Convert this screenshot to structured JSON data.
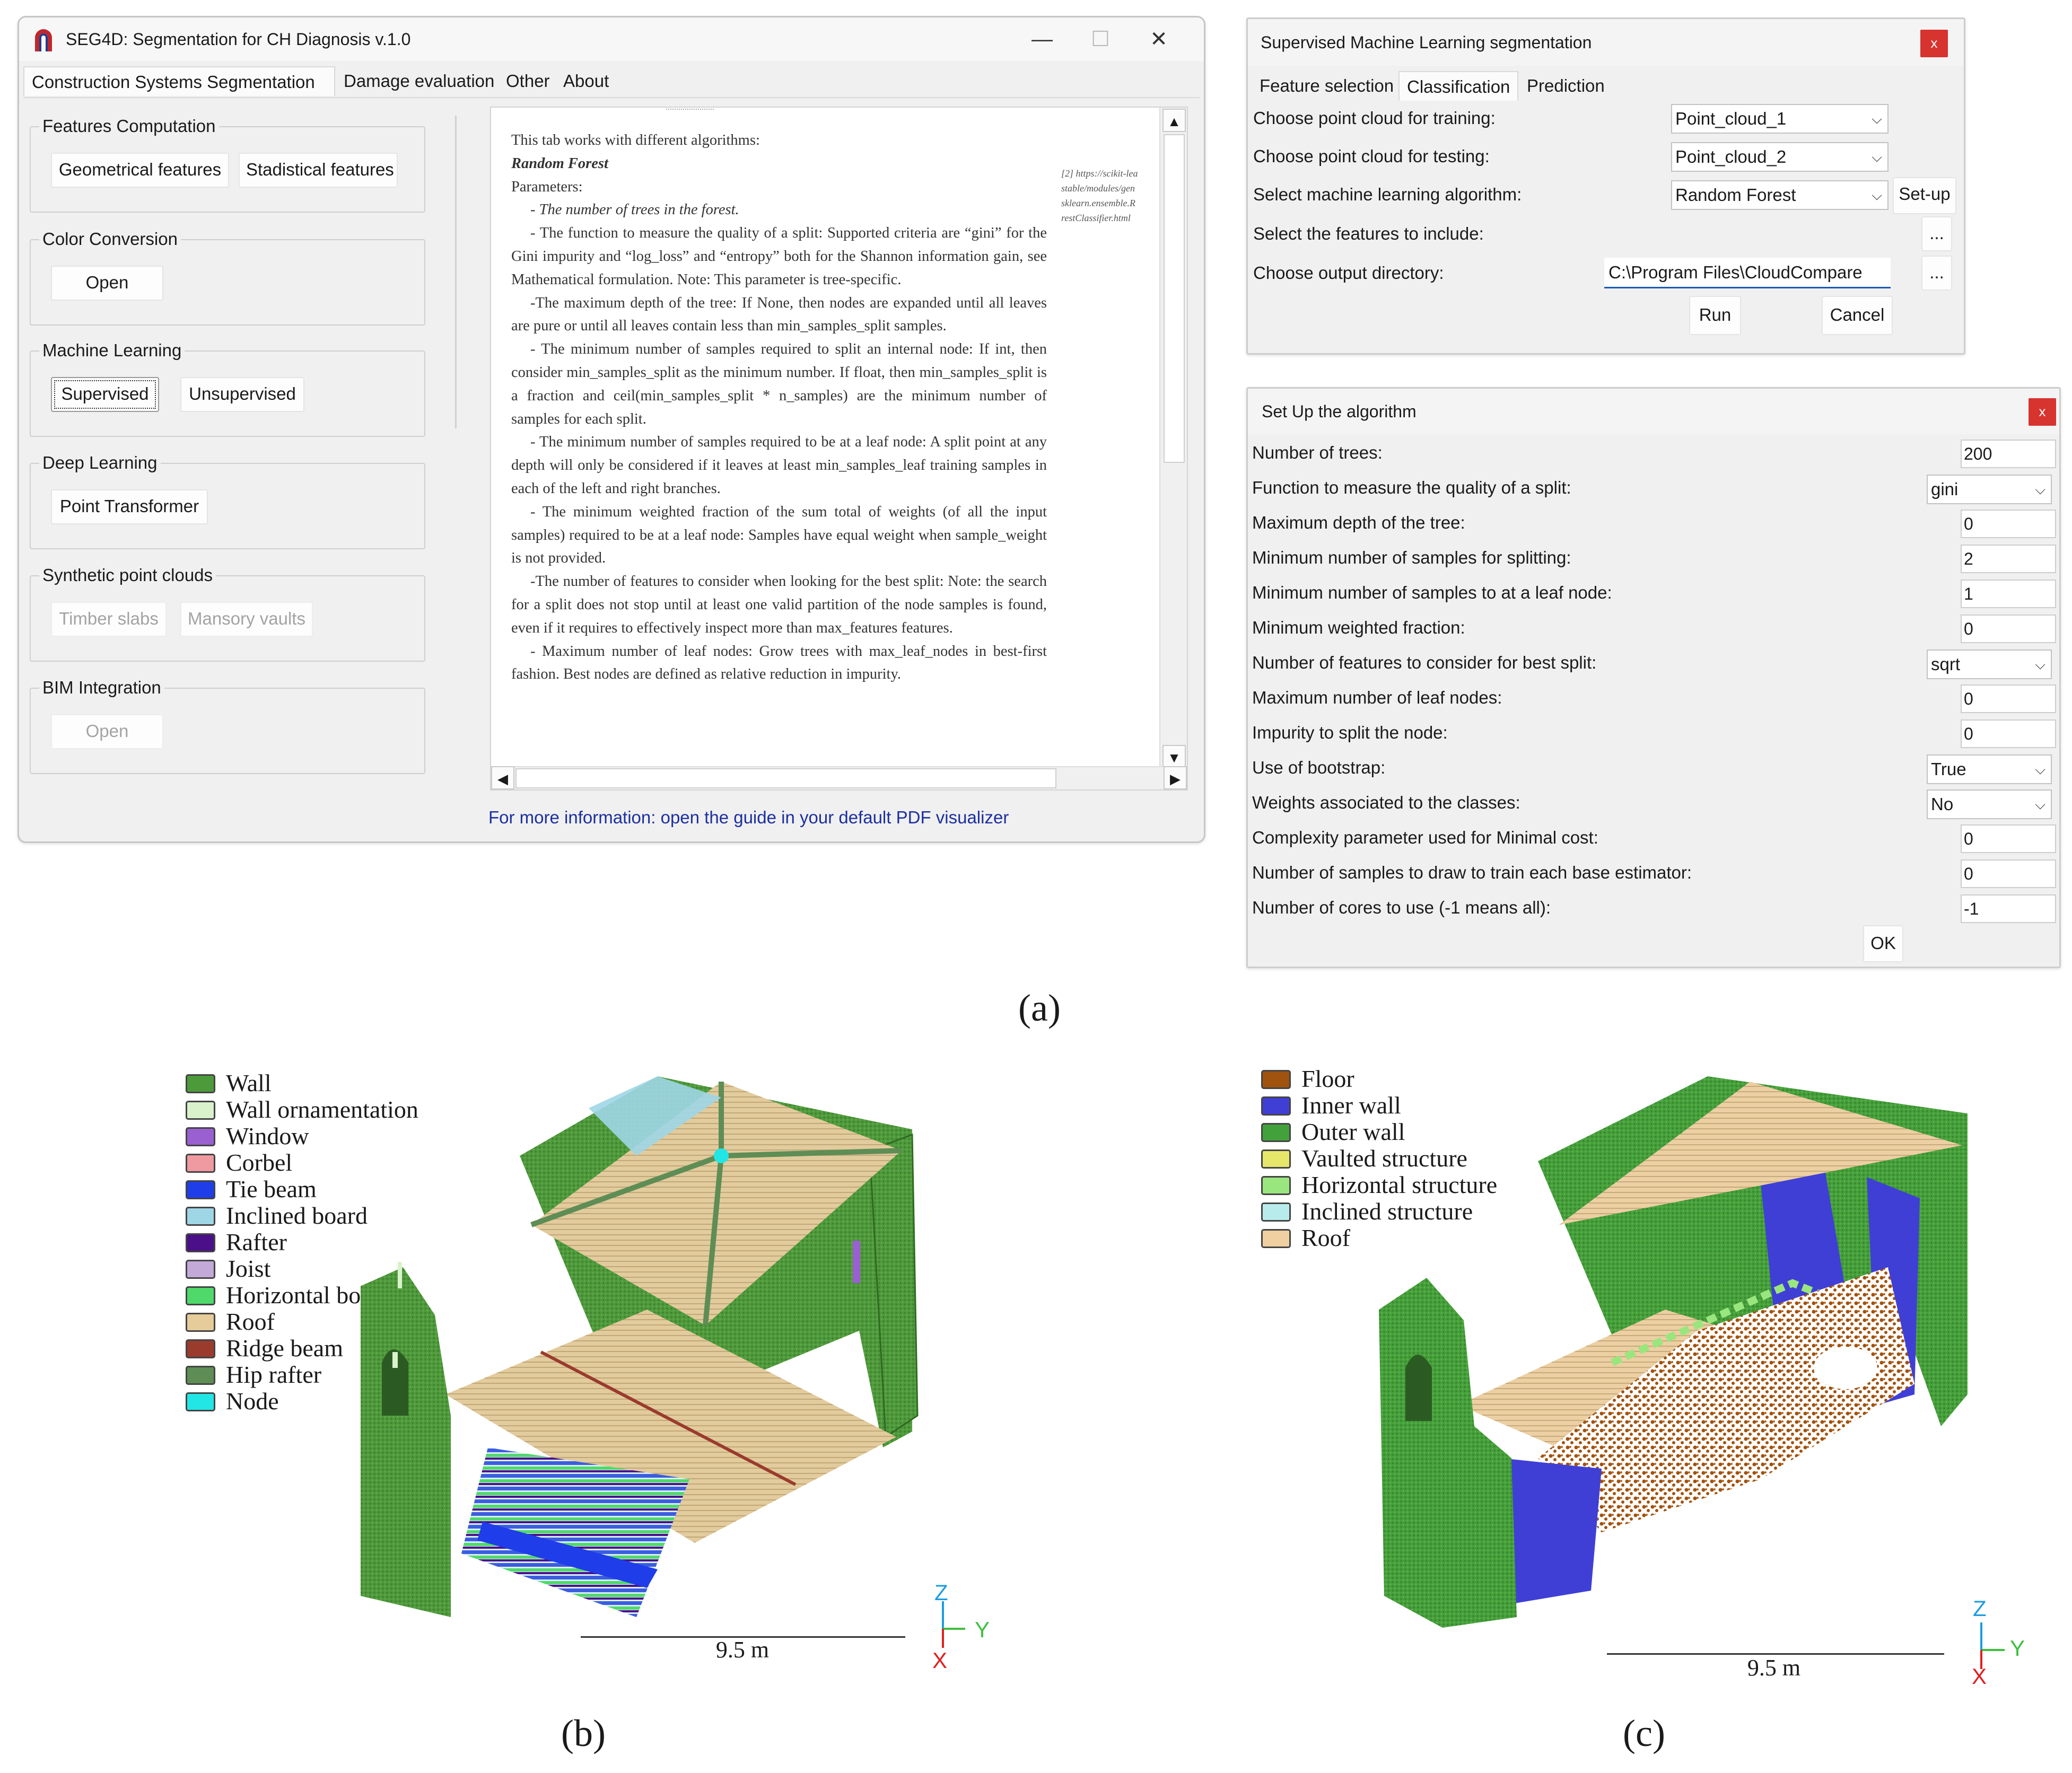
{
  "panel_a": {
    "caption": "(a)",
    "main_window": {
      "title": "SEG4D: Segmentation for CH Diagnosis v.1.0",
      "tabs": [
        "Construction Systems Segmentation",
        "Damage evaluation",
        "Other",
        "About"
      ],
      "groups": [
        {
          "label": "Features Computation",
          "buttons": [
            "Geometrical features",
            "Stadistical features"
          ]
        },
        {
          "label": "Color Conversion",
          "buttons": [
            "Open"
          ]
        },
        {
          "label": "Machine Learning",
          "buttons": [
            "Supervised",
            "Unsupervised"
          ]
        },
        {
          "label": "Deep Learning",
          "buttons": [
            "Point Transformer"
          ]
        },
        {
          "label": "Synthetic point clouds",
          "buttons": [
            "Timber slabs",
            "Mansory vaults"
          ]
        },
        {
          "label": "BIM Integration",
          "buttons": [
            "Open"
          ]
        }
      ],
      "doc_paragraphs": [
        "This tab works with different algorithms:",
        "Random Forest",
        "Parameters:",
        "- The number of trees in the forest.",
        "- The function to measure the quality of a split: Supported criteria are “gini” for the Gini impurity and “log_loss” and “entropy” both for the Shannon information gain, see Mathematical formulation. Note: This parameter is tree-specific.",
        "-The maximum depth of the tree: If None, then nodes are expanded until all leaves are pure or until all leaves contain less than min_samples_split samples.",
        "- The minimum number of samples required to split an internal node: If int, then consider min_samples_split as the minimum number. If float, then min_samples_split is a fraction and ceil(min_samples_split * n_samples) are the minimum number of samples for each split.",
        "- The minimum number of samples required to be at a leaf node: A split point at any depth will only be considered if it leaves at least min_samples_leaf training samples in each of the left and right branches.",
        "- The minimum weighted fraction of the sum total of weights (of all the input samples) required to be at a leaf node: Samples have equal weight when sample_weight is not provided.",
        "-The number of features to consider when looking for the best split: Note: the search for a split does not stop until at least one valid partition of the node samples is found, even if it requires to effectively inspect more than max_features features.",
        "- Maximum number of leaf nodes: Grow trees with max_leaf_nodes in best-first fashion. Best nodes are defined as relative reduction in impurity."
      ],
      "doc_note": "[2] https://scikit-lea stable/modules/gen sklearn.ensemble.R restClassifier.html",
      "pdf_link": "For more information: open the guide in your default PDF visualizer"
    },
    "sml_window": {
      "title": "Supervised Machine Learning segmentation",
      "tabs": [
        "Feature selection",
        "Classification",
        "Prediction"
      ],
      "rows": {
        "train_label": "Choose point cloud for training:",
        "train_value": "Point_cloud_1",
        "test_label": "Choose point cloud for testing:",
        "test_value": "Point_cloud_2",
        "algo_label": "Select machine learning algorithm:",
        "algo_value": "Random Forest",
        "setup_button": "Set-up",
        "features_label": "Select the features to include:",
        "browse": "...",
        "output_label": "Choose output directory:",
        "output_value": "C:\\Program Files\\CloudCompare"
      },
      "run_button": "Run",
      "cancel_button": "Cancel",
      "close": "x"
    },
    "setup_window": {
      "title": "Set Up the algorithm",
      "close": "x",
      "ok_button": "OK",
      "params": [
        {
          "label": "Number of trees:",
          "value": "200",
          "kind": "text"
        },
        {
          "label": "Function to measure the quality of a split:",
          "value": "gini",
          "kind": "combo"
        },
        {
          "label": "Maximum depth of the tree:",
          "value": "0",
          "kind": "text"
        },
        {
          "label": "Minimum number of samples for splitting:",
          "value": "2",
          "kind": "text"
        },
        {
          "label": "Minimum number of samples to at a leaf node:",
          "value": "1",
          "kind": "text"
        },
        {
          "label": "Minimum weighted fraction:",
          "value": "0",
          "kind": "text"
        },
        {
          "label": "Number of features to consider for best split:",
          "value": "sqrt",
          "kind": "combo"
        },
        {
          "label": "Maximum number of leaf nodes:",
          "value": "0",
          "kind": "text"
        },
        {
          "label": "Impurity to split the node:",
          "value": "0",
          "kind": "text"
        },
        {
          "label": "Use of bootstrap:",
          "value": "True",
          "kind": "combo"
        },
        {
          "label": "Weights associated to the classes:",
          "value": "No",
          "kind": "combo"
        },
        {
          "label": "Complexity parameter used for Minimal cost:",
          "value": "0",
          "kind": "text"
        },
        {
          "label": "Number of samples to draw to train each base estimator:",
          "value": "0",
          "kind": "text"
        },
        {
          "label": "Number of cores to use (-1 means all):",
          "value": "-1",
          "kind": "text"
        }
      ]
    }
  },
  "panel_b": {
    "caption": "(b)",
    "legend": [
      {
        "label": "Wall",
        "color": "#4d9a3a"
      },
      {
        "label": "Wall ornamentation",
        "color": "#d9f2cc"
      },
      {
        "label": "Window",
        "color": "#9a5fd1"
      },
      {
        "label": "Corbel",
        "color": "#ee9aa0"
      },
      {
        "label": "Tie beam",
        "color": "#1f3de8"
      },
      {
        "label": "Inclined board",
        "color": "#9fd6e6"
      },
      {
        "label": "Rafter",
        "color": "#4b0f8a"
      },
      {
        "label": "Joist",
        "color": "#c3a9d8"
      },
      {
        "label": "Horizontal board",
        "color": "#4fd96b"
      },
      {
        "label": "Roof",
        "color": "#e6cc9a"
      },
      {
        "label": "Ridge beam",
        "color": "#9a3b2d"
      },
      {
        "label": "Hip rafter",
        "color": "#5e8d55"
      },
      {
        "label": "Node",
        "color": "#22e6e6"
      }
    ],
    "scale_label": "9.5 m",
    "axes": {
      "z": "Z",
      "y": "Y",
      "x": "X"
    }
  },
  "panel_c": {
    "caption": "(c)",
    "legend": [
      {
        "label": "Floor",
        "color": "#a0520f"
      },
      {
        "label": "Inner wall",
        "color": "#3f3fd6"
      },
      {
        "label": "Outer wall",
        "color": "#43a13c"
      },
      {
        "label": "Vaulted structure",
        "color": "#e6e66a"
      },
      {
        "label": "Horizontal structure",
        "color": "#9ae67e"
      },
      {
        "label": "Inclined structure",
        "color": "#b8ecec"
      },
      {
        "label": "Roof",
        "color": "#f0cfa0"
      }
    ],
    "scale_label": "9.5 m",
    "axes": {
      "z": "Z",
      "y": "Y",
      "x": "X"
    }
  }
}
